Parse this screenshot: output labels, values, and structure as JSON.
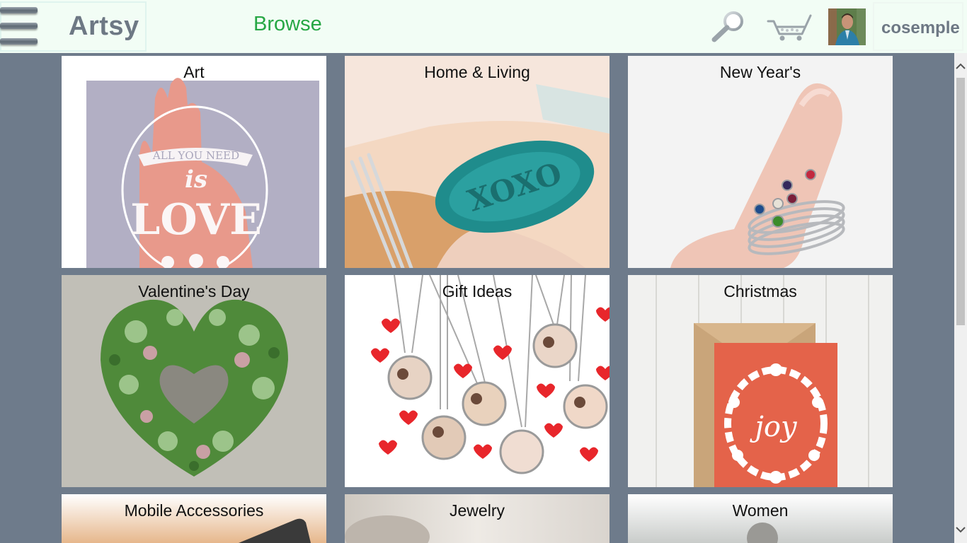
{
  "header": {
    "brand": "Artsy",
    "nav_browse": "Browse",
    "username": "cosemple",
    "icons": [
      "menu-icon",
      "search-icon",
      "cart-icon",
      "avatar"
    ]
  },
  "categories": [
    {
      "label": "Art"
    },
    {
      "label": "Home & Living"
    },
    {
      "label": "New Year's"
    },
    {
      "label": "Valentine's Day"
    },
    {
      "label": "Gift Ideas"
    },
    {
      "label": "Christmas"
    },
    {
      "label": "Mobile Accessories"
    },
    {
      "label": "Jewelry"
    },
    {
      "label": "Women"
    }
  ],
  "colors": {
    "header_bg": "#f2fdf5",
    "page_bg": "#6e7b8b",
    "brand_text": "#6d7884",
    "browse_link": "#27a745"
  },
  "artwork_text": {
    "art_banner": "ALL YOU NEED",
    "art_is": "is",
    "art_love": "LOVE",
    "home_dish": "XOXO",
    "christmas_card": "joy"
  }
}
